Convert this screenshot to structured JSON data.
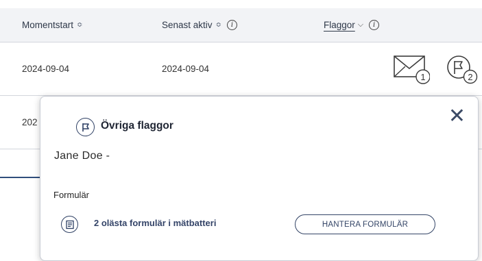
{
  "table": {
    "headers": {
      "momentstart": "Momentstart",
      "senast_aktiv": "Senast aktiv",
      "flaggor": "Flaggor",
      "sort_glyph": "≎",
      "chevron_glyph": "⌵",
      "info_glyph": "i"
    },
    "rows": [
      {
        "momentstart": "2024-09-04",
        "senast_aktiv": "2024-09-04",
        "message_count": "1",
        "flag_count": "2"
      },
      {
        "momentstart": "202"
      }
    ]
  },
  "popup": {
    "title": "Övriga flaggor",
    "name": "Jane Doe -",
    "close_glyph": "✕",
    "section_label": "Formulär",
    "form_link": "2 olästa formulär i mätbatteri",
    "manage_button": "HANTERA FORMULÄR"
  },
  "colors": {
    "primary": "#2d3f63",
    "header_bg": "#f2f3f6",
    "border": "#d2d5dc"
  },
  "icons": [
    "sort-icon",
    "chevron-down-icon",
    "info-icon",
    "envelope-icon",
    "flag-icon",
    "close-icon",
    "form-list-icon"
  ]
}
